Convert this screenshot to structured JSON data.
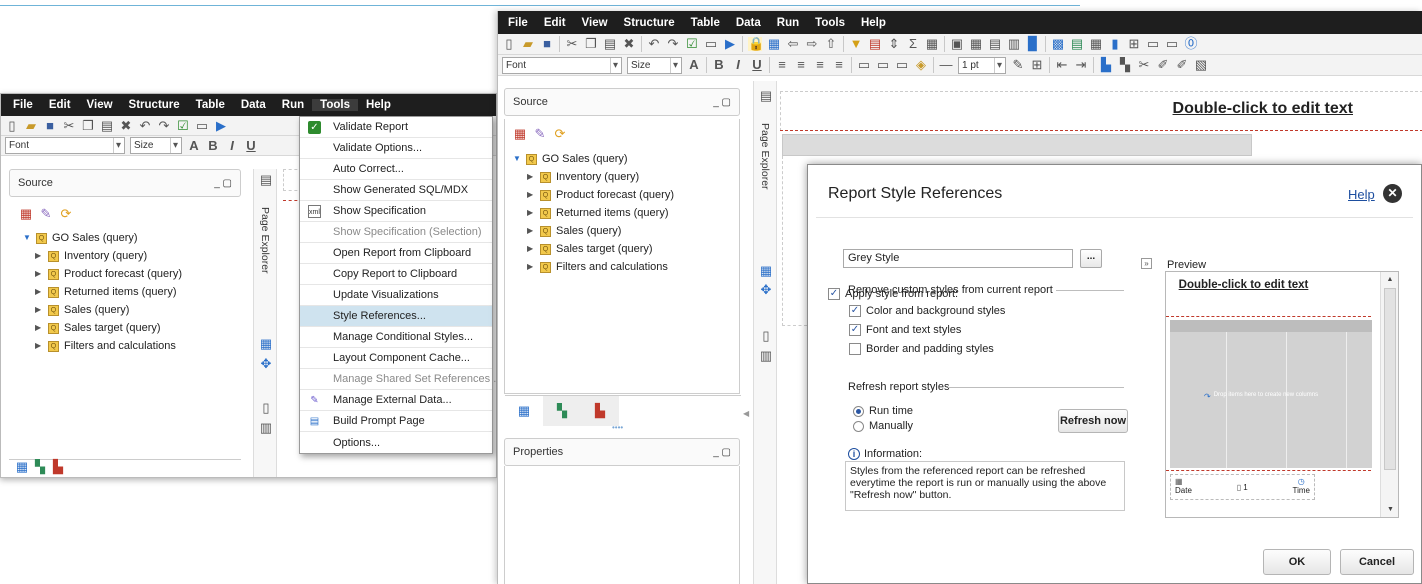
{
  "menu_labels": [
    "File",
    "Edit",
    "View",
    "Structure",
    "Table",
    "Data",
    "Run",
    "Tools",
    "Help"
  ],
  "toolbar": {
    "font": "Font",
    "size": "Size",
    "line_width": "1 pt"
  },
  "left_window": {
    "source_title": "Source",
    "page_explorer": "Page Explorer"
  },
  "tree": {
    "root": "GO Sales (query)",
    "items": [
      "Inventory (query)",
      "Product forecast (query)",
      "Returned items (query)",
      "Sales (query)",
      "Sales target (query)",
      "Filters and calculations"
    ]
  },
  "tools_menu": [
    {
      "label": "Validate Report",
      "icon": "check-icon",
      "disabled": false,
      "highlighted": false
    },
    {
      "label": "Validate Options...",
      "icon": "",
      "disabled": false,
      "highlighted": false
    },
    {
      "label": "Auto Correct...",
      "icon": "",
      "disabled": false,
      "highlighted": false
    },
    {
      "label": "Show Generated SQL/MDX",
      "icon": "",
      "disabled": false,
      "highlighted": false
    },
    {
      "label": "Show Specification",
      "icon": "xml-icon",
      "disabled": false,
      "highlighted": false
    },
    {
      "label": "Show Specification (Selection)",
      "icon": "",
      "disabled": true,
      "highlighted": false
    },
    {
      "label": "Open Report from Clipboard",
      "icon": "",
      "disabled": false,
      "highlighted": false
    },
    {
      "label": "Copy Report to Clipboard",
      "icon": "",
      "disabled": false,
      "highlighted": false
    },
    {
      "label": "Update Visualizations",
      "icon": "",
      "disabled": false,
      "highlighted": false
    },
    {
      "label": "Style References...",
      "icon": "",
      "disabled": false,
      "highlighted": true
    },
    {
      "label": "Manage Conditional Styles...",
      "icon": "",
      "disabled": false,
      "highlighted": false
    },
    {
      "label": "Layout Component Cache...",
      "icon": "",
      "disabled": false,
      "highlighted": false
    },
    {
      "label": "Manage Shared Set References ...",
      "icon": "",
      "disabled": true,
      "highlighted": false
    },
    {
      "label": "Manage External Data...",
      "icon": "data-icon",
      "disabled": false,
      "highlighted": false
    },
    {
      "label": "Build Prompt Page",
      "icon": "prompt-page-icon",
      "disabled": false,
      "highlighted": false
    },
    {
      "label": "Options...",
      "icon": "",
      "disabled": false,
      "highlighted": false
    }
  ],
  "right_window": {
    "source_title": "Source",
    "properties_title": "Properties",
    "page_explorer": "Page Explorer",
    "canvas_text": "Double-click to edit text"
  },
  "dialog": {
    "title": "Report Style References",
    "help": "Help",
    "apply_label": "Apply style from report:",
    "apply_checked": true,
    "style_value": "Grey Style",
    "browse": "...",
    "remove_section": "Remove custom styles from current report",
    "remove_options": [
      {
        "label": "Color and background styles",
        "checked": true
      },
      {
        "label": "Font and text styles",
        "checked": true
      },
      {
        "label": "Border and padding styles",
        "checked": false
      }
    ],
    "refresh_section": "Refresh report styles",
    "refresh_options": [
      {
        "label": "Run time",
        "checked": true
      },
      {
        "label": "Manually",
        "checked": false
      }
    ],
    "refresh_now": "Refresh now",
    "info_title": "Information:",
    "info_text": "Styles from the referenced report can be refreshed everytime the report is run or manually using the above \"Refresh now\" button.",
    "preview_title": "Preview",
    "preview_heading": "Double-click to edit text",
    "preview_drop": "Drop items here to create new columns",
    "preview_footer": [
      "Date",
      "1",
      "Time"
    ],
    "ok": "OK",
    "cancel": "Cancel"
  },
  "colors": {
    "menubar": "#1e1e1e",
    "highlight": "#cfe3ef",
    "accent_red": "#c0392b"
  }
}
